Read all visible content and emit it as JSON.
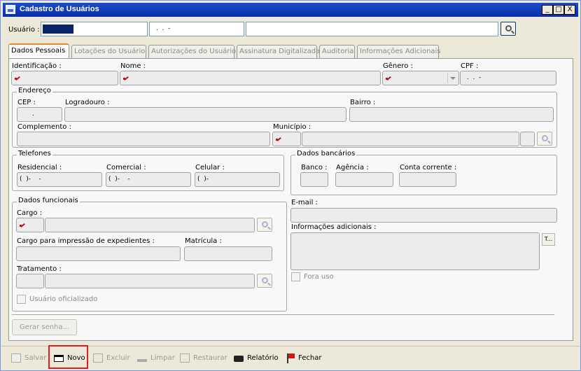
{
  "window": {
    "title": "Cadastro de Usuários",
    "buttons": [
      "_",
      "□",
      "X"
    ]
  },
  "usuario": {
    "label": "Usuário :",
    "field2": " .  .  -",
    "field3": ""
  },
  "tabs": [
    "Dados Pessoais",
    "Lotações do Usuário",
    "Autorizações do Usuário",
    "Assinatura Digitalizada",
    "Auditoria",
    "Informações Adicionais"
  ],
  "identificacao": {
    "label": "Identificação :"
  },
  "nome": {
    "label": "Nome :"
  },
  "genero": {
    "label": "Gênero :"
  },
  "cpf": {
    "label": "CPF :",
    "value": " .  .  -"
  },
  "endereco": {
    "group": "Endereço",
    "cep": "CEP :",
    "cep_value": " .",
    "logradouro": "Logradouro :",
    "bairro": "Bairro :",
    "complemento": "Complemento :",
    "municipio": "Município :"
  },
  "telefones": {
    "group": "Telefones",
    "residencial": "Residencial :",
    "comercial": "Comercial :",
    "celular": "Celular :",
    "res_value": "(  )-    -",
    "com_value": "(  )-    -",
    "cel_value": "(  )-"
  },
  "bancarios": {
    "group": "Dados bancários",
    "banco": "Banco :",
    "agencia": "Agência :",
    "conta": "Conta corrente :"
  },
  "funcionais": {
    "group": "Dados funcionais",
    "cargo": "Cargo :",
    "cargo_impressao": "Cargo para impressão de expedientes :",
    "matricula": "Matrícula :",
    "tratamento": "Tratamento :",
    "oficializado": "Usuário oficializado"
  },
  "email": {
    "label": "E-mail :"
  },
  "info": {
    "label": "Informações adicionais :",
    "text_btn": "T..."
  },
  "fora_uso": {
    "label": "Fora uso"
  },
  "gerar_senha": "Gerar senha...",
  "toolbar": {
    "salvar": "Salvar",
    "novo": "Novo",
    "excluir": "Excluir",
    "limpar": "Limpar",
    "restaurar": "Restaurar",
    "relatorio": "Relatório",
    "fechar": "Fechar"
  },
  "colors": {
    "title_bar": "#0a2ea8",
    "highlight": "#e02020",
    "required": "#c0101a",
    "tab_active": "#e68b2c"
  }
}
